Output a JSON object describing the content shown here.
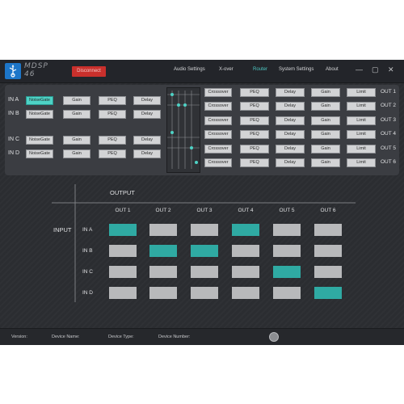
{
  "app": {
    "logo_text": "MDSP\n46",
    "disconnect_label": "Disconnect",
    "nav": [
      "Audio Settings",
      "X-over",
      "Router",
      "System Settings",
      "About"
    ],
    "active_nav": "Router",
    "window_controls": {
      "minimize": "—",
      "maximize": "▢",
      "close": "✕"
    }
  },
  "inputs_panel": {
    "inputs": [
      {
        "label": "IN A",
        "buttons": [
          "NoiseGate",
          "Gain",
          "PEQ",
          "Delay"
        ],
        "noisegate_on": true
      },
      {
        "label": "IN B",
        "buttons": [
          "NoiseGate",
          "Gain",
          "PEQ",
          "Delay"
        ],
        "noisegate_on": false
      },
      {
        "label": "IN C",
        "buttons": [
          "NoiseGate",
          "Gain",
          "PEQ",
          "Delay"
        ],
        "noisegate_on": false
      },
      {
        "label": "IN D",
        "buttons": [
          "NoiseGate",
          "Gain",
          "PEQ",
          "Delay"
        ],
        "noisegate_on": false
      }
    ],
    "outputs": [
      {
        "label": "OUT 1",
        "buttons": [
          "Crossover",
          "PEQ",
          "Delay",
          "Gain",
          "Limit"
        ]
      },
      {
        "label": "OUT 2",
        "buttons": [
          "Crossover",
          "PEQ",
          "Delay",
          "Gain",
          "Limit"
        ]
      },
      {
        "label": "OUT 3",
        "buttons": [
          "Crossover",
          "PEQ",
          "Delay",
          "Gain",
          "Limit"
        ]
      },
      {
        "label": "OUT 4",
        "buttons": [
          "Crossover",
          "PEQ",
          "Delay",
          "Gain",
          "Limit"
        ]
      },
      {
        "label": "OUT 5",
        "buttons": [
          "Crossover",
          "PEQ",
          "Delay",
          "Gain",
          "Limit"
        ]
      },
      {
        "label": "OUT 6",
        "buttons": [
          "Crossover",
          "PEQ",
          "Delay",
          "Gain",
          "Limit"
        ]
      }
    ]
  },
  "matrix": {
    "output_title": "OUTPUT",
    "input_title": "INPUT",
    "columns": [
      "OUT 1",
      "OUT 2",
      "OUT 3",
      "OUT 4",
      "OUT 5",
      "OUT 6"
    ],
    "rows": [
      "IN A",
      "IN B",
      "IN C",
      "IN D"
    ],
    "active": [
      [
        true,
        false,
        false,
        true,
        false,
        false
      ],
      [
        false,
        true,
        true,
        false,
        false,
        false
      ],
      [
        false,
        false,
        false,
        false,
        true,
        false
      ],
      [
        false,
        false,
        false,
        false,
        false,
        true
      ]
    ]
  },
  "status": {
    "version": "Version:",
    "device_name": "Device Name:",
    "device_type": "Device Type:",
    "device_number": "Device Number:"
  },
  "colors": {
    "accent": "#4ec8c3",
    "matrix_on": "#2faaa3",
    "matrix_off": "#b8b9bb",
    "disconnect": "#c9302c"
  }
}
